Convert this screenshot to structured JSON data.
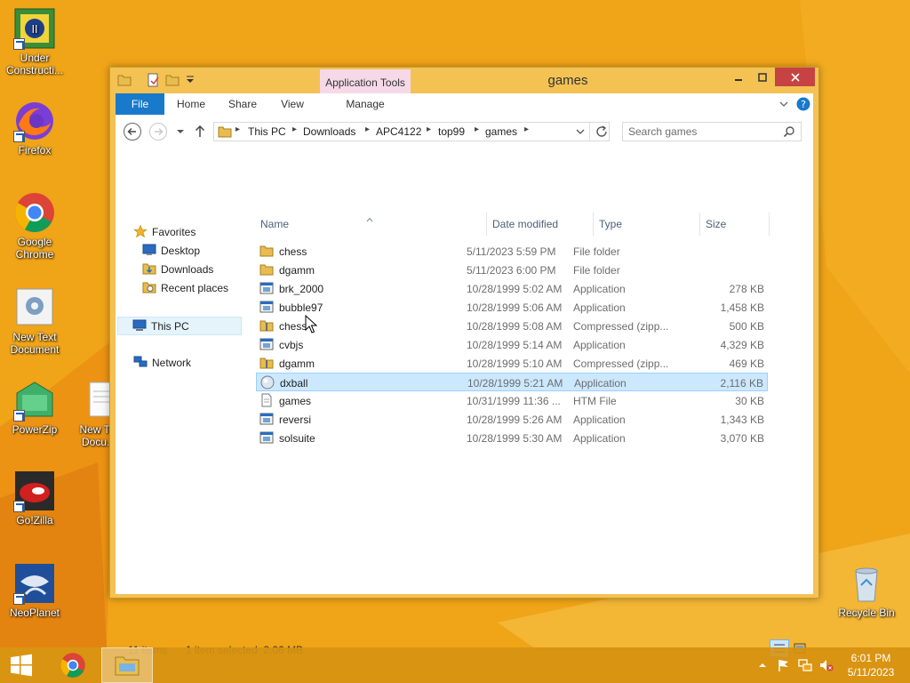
{
  "window": {
    "title": "games",
    "context_tab": "Application Tools",
    "ribbon_tabs": [
      "File",
      "Home",
      "Share",
      "View",
      "Manage"
    ]
  },
  "breadcrumb": [
    "This PC",
    "Downloads",
    "APC4122",
    "top99",
    "games"
  ],
  "search": {
    "placeholder": "Search games"
  },
  "nav": {
    "favorites": "Favorites",
    "desktop": "Desktop",
    "downloads": "Downloads",
    "recent": "Recent places",
    "this_pc": "This PC",
    "network": "Network"
  },
  "columns": {
    "name": "Name",
    "date": "Date modified",
    "type": "Type",
    "size": "Size"
  },
  "files": [
    {
      "name": "chess",
      "date": "5/11/2023 5:59 PM",
      "type": "File folder",
      "size": "",
      "icon": "folder-icon"
    },
    {
      "name": "dgamm",
      "date": "5/11/2023 6:00 PM",
      "type": "File folder",
      "size": "",
      "icon": "folder-icon"
    },
    {
      "name": "brk_2000",
      "date": "10/28/1999 5:02 AM",
      "type": "Application",
      "size": "278 KB",
      "icon": "app-icon"
    },
    {
      "name": "bubble97",
      "date": "10/28/1999 5:06 AM",
      "type": "Application",
      "size": "1,458 KB",
      "icon": "app-icon"
    },
    {
      "name": "chess",
      "date": "10/28/1999 5:08 AM",
      "type": "Compressed (zipp...",
      "size": "500 KB",
      "icon": "zip-folder-icon"
    },
    {
      "name": "cvbjs",
      "date": "10/28/1999 5:14 AM",
      "type": "Application",
      "size": "4,329 KB",
      "icon": "app-icon"
    },
    {
      "name": "dgamm",
      "date": "10/28/1999 5:10 AM",
      "type": "Compressed (zipp...",
      "size": "469 KB",
      "icon": "zip-folder-icon"
    },
    {
      "name": "dxball",
      "date": "10/28/1999 5:21 AM",
      "type": "Application",
      "size": "2,116 KB",
      "icon": "ball-icon"
    },
    {
      "name": "games",
      "date": "10/31/1999 11:36 ...",
      "type": "HTM File",
      "size": "30 KB",
      "icon": "document-icon"
    },
    {
      "name": "reversi",
      "date": "10/28/1999 5:26 AM",
      "type": "Application",
      "size": "1,343 KB",
      "icon": "app-icon"
    },
    {
      "name": "solsuite",
      "date": "10/28/1999 5:30 AM",
      "type": "Application",
      "size": "3,070 KB",
      "icon": "app-icon"
    }
  ],
  "status": {
    "count": "11 items",
    "selection": "1 item selected  2.06 MB"
  },
  "desktop_icons": [
    {
      "label": "Under Constructi...",
      "icon": "under-construction-icon"
    },
    {
      "label": "Firefox",
      "icon": "firefox-icon"
    },
    {
      "label": "Google Chrome",
      "icon": "chrome-icon"
    },
    {
      "label": "New Text Document",
      "icon": "text-document-icon"
    },
    {
      "label": "PowerZip",
      "icon": "powerzip-icon"
    },
    {
      "label": "New T... Docu...",
      "icon": "text-document-icon"
    },
    {
      "label": "Go!Zilla",
      "icon": "gozilla-icon"
    },
    {
      "label": "NeoPlanet",
      "icon": "neoplanet-icon"
    },
    {
      "label": "Recycle Bin",
      "icon": "recycle-bin-icon"
    }
  ],
  "taskbar": {
    "time": "6:01 PM",
    "date": "5/11/2023"
  },
  "colors": {
    "accent": "#1979ca",
    "desktop": "#f0a418",
    "selection": "#cce8ff",
    "close": "#c74343"
  }
}
